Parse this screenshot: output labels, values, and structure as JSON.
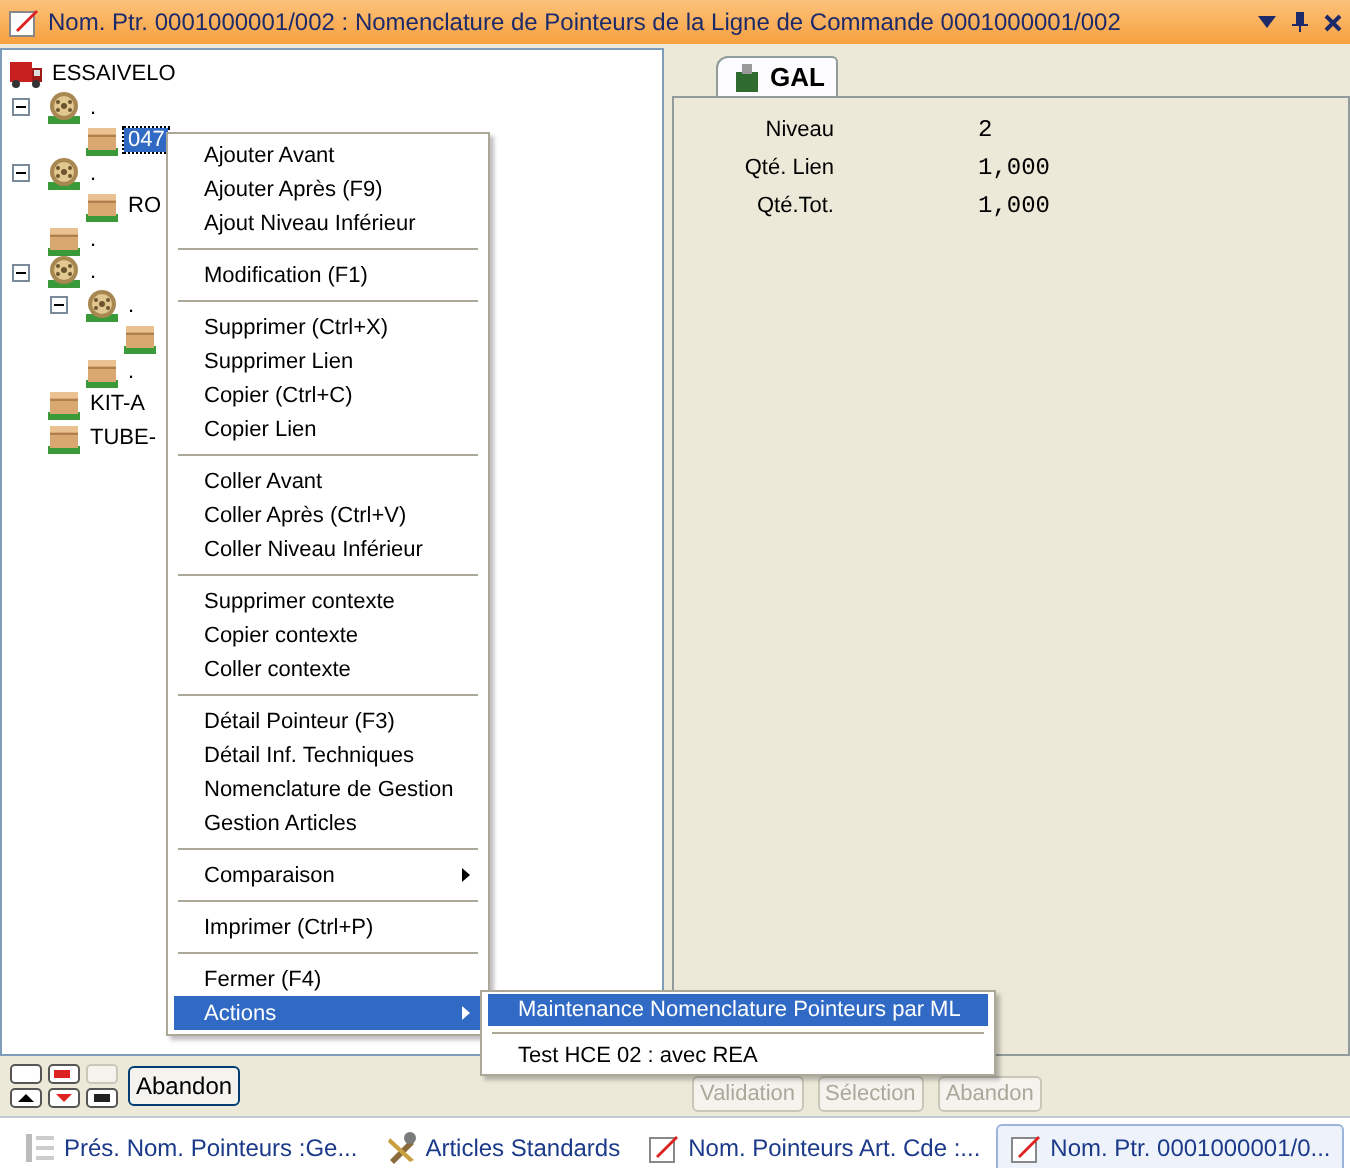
{
  "window": {
    "title": "Nom. Ptr. 0001000001/002 : Nomenclature de Pointeurs de la Ligne de Commande 0001000001/002"
  },
  "tree": {
    "label": "ESSAIVELO",
    "kind": "truck",
    "children": [
      {
        "label": ".",
        "kind": "gear",
        "expanded": true,
        "children": [
          {
            "label": "047",
            "kind": "box",
            "selected": true
          }
        ]
      },
      {
        "label": ".",
        "kind": "gear",
        "expanded": true,
        "children": [
          {
            "label": "RO",
            "kind": "box",
            "selected": false
          }
        ]
      },
      {
        "label": ".",
        "kind": "box",
        "selected": false
      },
      {
        "label": ".",
        "kind": "gear",
        "expanded": true,
        "children": [
          {
            "label": ".",
            "kind": "gear",
            "expanded": true,
            "children": [
              {
                "kind": "box",
                "selected": false
              }
            ]
          },
          {
            "label": ".",
            "kind": "box",
            "selected": false
          }
        ]
      },
      {
        "label": "KIT-A",
        "kind": "box",
        "selected": false
      },
      {
        "label": "TUBE-",
        "kind": "box",
        "selected": false
      }
    ]
  },
  "detail": {
    "tab": {
      "label": "GAL",
      "selected": true
    },
    "fields": [
      {
        "label": "Niveau",
        "value": "2"
      },
      {
        "label": "Qté. Lien",
        "value": "1,000"
      },
      {
        "label": "Qté.Tot.",
        "value": "1,000"
      }
    ]
  },
  "context_menu": [
    [
      {
        "label": "Ajouter Avant",
        "submenu": false,
        "selected": false
      },
      {
        "label": "Ajouter Après (F9)",
        "submenu": false,
        "selected": false
      },
      {
        "label": "Ajout Niveau Inférieur",
        "submenu": false,
        "selected": false
      }
    ],
    [
      {
        "label": "Modification (F1)",
        "submenu": false,
        "selected": false
      }
    ],
    [
      {
        "label": "Supprimer (Ctrl+X)",
        "submenu": false,
        "selected": false
      },
      {
        "label": "Supprimer Lien",
        "submenu": false,
        "selected": false
      },
      {
        "label": "Copier (Ctrl+C)",
        "submenu": false,
        "selected": false
      },
      {
        "label": "Copier Lien",
        "submenu": false,
        "selected": false
      }
    ],
    [
      {
        "label": "Coller Avant",
        "submenu": false,
        "selected": false
      },
      {
        "label": "Coller Après (Ctrl+V)",
        "submenu": false,
        "selected": false
      },
      {
        "label": "Coller Niveau Inférieur",
        "submenu": false,
        "selected": false
      }
    ],
    [
      {
        "label": "Supprimer contexte",
        "submenu": false,
        "selected": false
      },
      {
        "label": "Copier contexte",
        "submenu": false,
        "selected": false
      },
      {
        "label": "Coller contexte",
        "submenu": false,
        "selected": false
      }
    ],
    [
      {
        "label": "Détail Pointeur (F3)",
        "submenu": false,
        "selected": false
      },
      {
        "label": "Détail Inf. Techniques",
        "submenu": false,
        "selected": false
      },
      {
        "label": "Nomenclature de Gestion",
        "submenu": false,
        "selected": false
      },
      {
        "label": "Gestion Articles",
        "submenu": false,
        "selected": false
      }
    ],
    [
      {
        "label": "Comparaison",
        "submenu": true,
        "selected": false
      }
    ],
    [
      {
        "label": "Imprimer (Ctrl+P)",
        "submenu": false,
        "selected": false
      }
    ],
    [
      {
        "label": "Fermer (F4)",
        "submenu": false,
        "selected": false
      },
      {
        "label": "Actions",
        "submenu": true,
        "selected": true
      }
    ]
  ],
  "submenu": [
    [
      {
        "label": "Maintenance Nomenclature Pointeurs par ML",
        "selected": true
      }
    ],
    [
      {
        "label": "Test HCE 02 : avec REA",
        "selected": false
      }
    ]
  ],
  "toolbar": {
    "abandon_button": "Abandon",
    "buttons": [
      {
        "label": "Validation",
        "disabled": true
      },
      {
        "label": "Sélection",
        "disabled": true
      },
      {
        "label": "Abandon",
        "disabled": true
      }
    ]
  },
  "taskbar": [
    {
      "label": "Prés. Nom. Pointeurs :Ge...",
      "kind": "list",
      "selected": false
    },
    {
      "label": "Articles Standards",
      "kind": "tools",
      "selected": false
    },
    {
      "label": "Nom. Pointeurs Art. Cde :...",
      "kind": "pencil",
      "selected": false
    },
    {
      "label": "Nom. Ptr. 0001000001/0...",
      "kind": "pencil",
      "selected": true
    }
  ]
}
